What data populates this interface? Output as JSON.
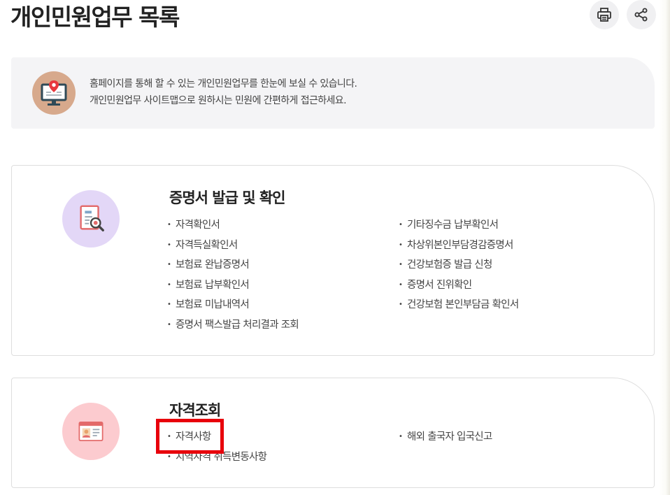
{
  "page_title": "개인민원업무 목록",
  "toolbar": {
    "print_icon": "printer-icon",
    "share_icon": "share-icon"
  },
  "notice": {
    "icon": "monitor-location-icon",
    "line1": "홈페이지를 통해 할 수 있는 개인민원업무를 한눈에 보실 수 있습니다.",
    "line2": "개인민원업무 사이트맵으로 원하시는 민원에 간편하게 접근하세요."
  },
  "sections": [
    {
      "title": "증명서 발급 및 확인",
      "icon": "document-search-icon",
      "left_items": [
        "자격확인서",
        "자격득실확인서",
        "보험료 완납증명서",
        "보험료 납부확인서",
        "보험료 미납내역서",
        "증명서 팩스발급 처리결과 조회"
      ],
      "right_items": [
        "기타징수금 납부확인서",
        "차상위본인부담경감증명서",
        "건강보험증 발급 신청",
        "증명서 진위확인",
        "건강보험 본인부담금 확인서"
      ]
    },
    {
      "title": "자격조회",
      "icon": "id-card-icon",
      "left_items": [
        "자격사항",
        "지역자격 취득변동사항"
      ],
      "right_items": [
        "해외 출국자 입국신고"
      ]
    }
  ],
  "colors": {
    "highlight": "#e8000b",
    "section1_icon_bg": "#e3d7f7",
    "section2_icon_bg": "#fccbcf",
    "notice_icon_bg": "#d7a98c"
  }
}
